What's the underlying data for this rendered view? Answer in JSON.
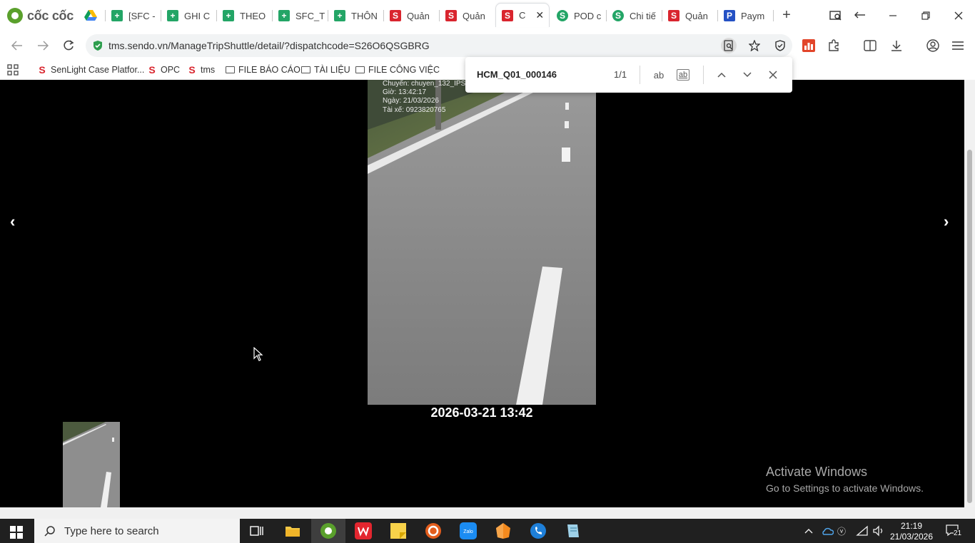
{
  "browser": {
    "brand": "cốc cốc",
    "tabs": [
      {
        "label": "",
        "icon": "google-drive-icon"
      },
      {
        "label": "[SFC -",
        "icon": "sheets-icon"
      },
      {
        "label": "GHI C",
        "icon": "sheets-icon"
      },
      {
        "label": "THEO",
        "icon": "sheets-icon"
      },
      {
        "label": "SFC_T",
        "icon": "sheets-icon"
      },
      {
        "label": "THÔN",
        "icon": "sheets-icon"
      },
      {
        "label": "Quản",
        "icon": "sendo-icon"
      },
      {
        "label": "Quản",
        "icon": "sendo-icon"
      },
      {
        "label": "C",
        "icon": "sendo-icon",
        "active": true
      },
      {
        "label": "POD c",
        "icon": "green-circle-icon"
      },
      {
        "label": "Chi tiế",
        "icon": "green-circle-icon"
      },
      {
        "label": "Quản",
        "icon": "sendo-icon"
      },
      {
        "label": "Paym",
        "icon": "paypal-icon"
      }
    ],
    "url": "tms.sendo.vn/ManageTripShuttle/detail/?dispatchcode=S26O6QSGBRG",
    "bookmarks": [
      {
        "label": "SenLight Case Platfor...",
        "icon": "sendo-icon"
      },
      {
        "label": "OPC",
        "icon": "sendo-icon"
      },
      {
        "label": "tms",
        "icon": "sendo-icon"
      },
      {
        "label": "FILE BÁO CÁO",
        "icon": "folder-icon"
      },
      {
        "label": "TÀI LIỆU",
        "icon": "folder-icon"
      },
      {
        "label": "FILE CÔNG VIỆC",
        "icon": "folder-icon"
      }
    ]
  },
  "find": {
    "query": "HCM_Q01_000146",
    "count": "1/1",
    "match_case": "ab",
    "whole_word": "ab"
  },
  "viewer": {
    "prev_label": "‹",
    "next_label": "›",
    "overlay": {
      "line1": "Chuyến: chuyen_132_IPS",
      "line2": "Giờ: 13:42:17",
      "line3": "Ngày: 21/03/2026",
      "line4": "Tài xế: 0923820765"
    },
    "caption": "2026-03-21 13:42"
  },
  "watermark": {
    "title": "Activate Windows",
    "subtitle": "Go to Settings to activate Windows."
  },
  "taskbar": {
    "search_placeholder": "Type here to search",
    "time": "21:19",
    "date": "21/03/2026",
    "notification_count": "21"
  }
}
